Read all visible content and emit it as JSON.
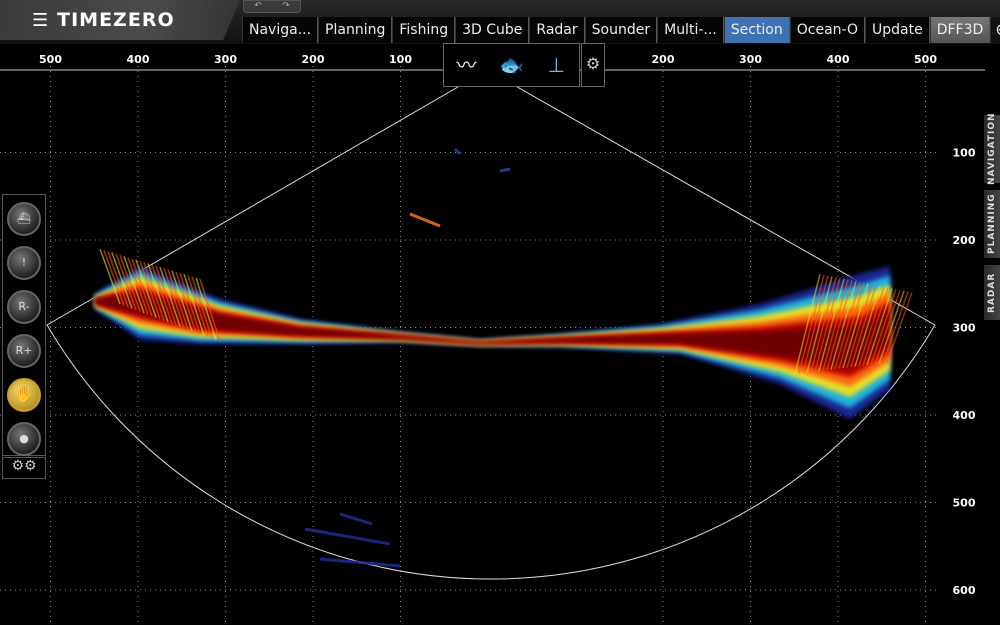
{
  "header": {
    "menu_icon": "hamburger-icon",
    "logo": "TIMEZERO",
    "undo_icon": "undo-icon",
    "redo_icon": "redo-icon"
  },
  "tabs": [
    {
      "label": "Naviga..."
    },
    {
      "label": "Planning"
    },
    {
      "label": "Fishing"
    },
    {
      "label": "3D Cube"
    },
    {
      "label": "Radar"
    },
    {
      "label": "Sounder"
    },
    {
      "label": "Multi-..."
    },
    {
      "label": "Section",
      "active": true
    },
    {
      "label": "Ocean-O"
    },
    {
      "label": "Update"
    },
    {
      "label": "DFF3D"
    }
  ],
  "add_tab_icon": "plus-circle-icon",
  "toolbar": {
    "icons": [
      "profile-cursor-icon",
      "fish-profile-icon",
      "profile-scale-icon"
    ],
    "settings_icon": "gears-lock-icon"
  },
  "left_tools": {
    "icons": [
      "boat-icon",
      "marker-icon",
      "range-minus-icon",
      "range-plus-icon",
      "pan-hand-icon",
      "eraser-icon"
    ],
    "range_minus": "R-",
    "range_plus": "R+",
    "settings_icon": "gears-lock-icon"
  },
  "side_tabs": [
    "NAVIGATION",
    "PLANNING",
    "RADAR"
  ],
  "x_axis": {
    "left_labels": [
      "500",
      "400",
      "300",
      "200",
      "100"
    ],
    "right_labels": [
      "200",
      "300",
      "400",
      "500"
    ]
  },
  "y_axis": {
    "labels": [
      "100",
      "200",
      "300",
      "400",
      "500",
      "600"
    ]
  },
  "colors": {
    "active_tab": "#3f72b5",
    "echo_strong": "#7a0000",
    "echo_weak": "#1a2a9a"
  }
}
